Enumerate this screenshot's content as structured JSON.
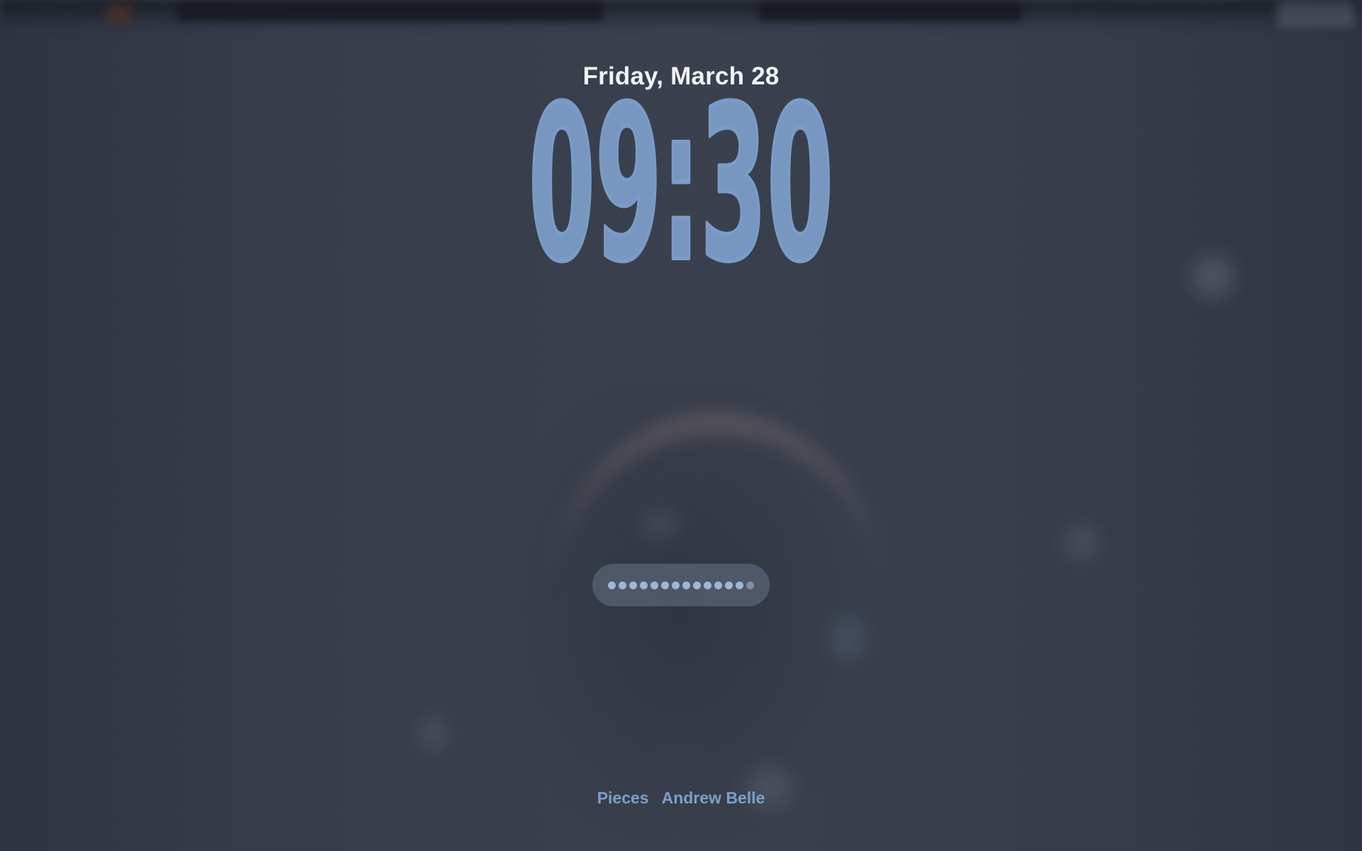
{
  "lock_screen": {
    "date": "Friday, March 28",
    "time": "09:30",
    "password": {
      "masked_length": 14,
      "field_label": "password-field"
    },
    "now_playing": {
      "track": "Pieces",
      "artist": "Andrew Belle"
    }
  },
  "colors": {
    "clock_fill": "#7a9cc6",
    "clock_stroke": "#7a9cc6",
    "date_text": "#f2f3f6",
    "now_playing_text": "#7c9fcb",
    "background": "#343a47"
  }
}
